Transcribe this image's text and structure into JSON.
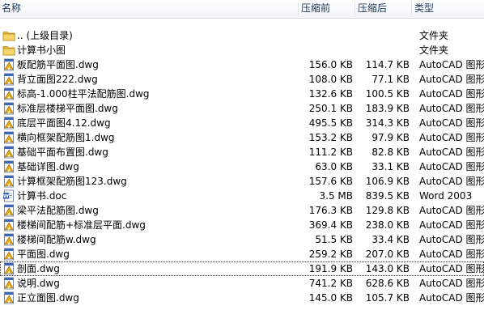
{
  "header": {
    "name": "名称",
    "original": "压缩前",
    "compressed": "压缩后",
    "type": "类型"
  },
  "rows": [
    {
      "name": ".. (上级目录)",
      "original": "",
      "compressed": "",
      "type": "文件夹",
      "icon": "folder-icon"
    },
    {
      "name": "计算书小图",
      "original": "",
      "compressed": "",
      "type": "文件夹",
      "icon": "folder-icon"
    },
    {
      "name": "板配筋平面图.dwg",
      "original": "156.0 KB",
      "compressed": "114.7 KB",
      "type": "AutoCAD 图形",
      "icon": "dwg-file-icon"
    },
    {
      "name": "背立面图222.dwg",
      "original": "108.0 KB",
      "compressed": "77.1 KB",
      "type": "AutoCAD 图形",
      "icon": "dwg-file-icon"
    },
    {
      "name": "标高-1.000柱平法配筋图.dwg",
      "original": "132.6 KB",
      "compressed": "100.5 KB",
      "type": "AutoCAD 图形",
      "icon": "dwg-file-icon"
    },
    {
      "name": "标准层楼梯平面图.dwg",
      "original": "250.1 KB",
      "compressed": "183.9 KB",
      "type": "AutoCAD 图形",
      "icon": "dwg-file-icon"
    },
    {
      "name": "底层平面图4.12.dwg",
      "original": "495.5 KB",
      "compressed": "314.3 KB",
      "type": "AutoCAD 图形",
      "icon": "dwg-file-icon"
    },
    {
      "name": "横向框架配筋图1.dwg",
      "original": "153.2 KB",
      "compressed": "97.9 KB",
      "type": "AutoCAD 图形",
      "icon": "dwg-file-icon"
    },
    {
      "name": "基础平面布置图.dwg",
      "original": "111.2 KB",
      "compressed": "82.8 KB",
      "type": "AutoCAD 图形",
      "icon": "dwg-file-icon"
    },
    {
      "name": "基础详图.dwg",
      "original": "63.0 KB",
      "compressed": "33.1 KB",
      "type": "AutoCAD 图形",
      "icon": "dwg-file-icon"
    },
    {
      "name": "计算框架配筋图123.dwg",
      "original": "157.6 KB",
      "compressed": "106.9 KB",
      "type": "AutoCAD 图形",
      "icon": "dwg-file-icon"
    },
    {
      "name": "计算书.doc",
      "original": "3.5 MB",
      "compressed": "839.5 KB",
      "type": "Word 2003",
      "icon": "word-doc-icon"
    },
    {
      "name": "梁平法配筋图.dwg",
      "original": "176.3 KB",
      "compressed": "129.8 KB",
      "type": "AutoCAD 图形",
      "icon": "dwg-file-icon"
    },
    {
      "name": "楼梯间配筋+标准层平面.dwg",
      "original": "369.4 KB",
      "compressed": "238.0 KB",
      "type": "AutoCAD 图形",
      "icon": "dwg-file-icon"
    },
    {
      "name": "楼梯间配筋w.dwg",
      "original": "51.5 KB",
      "compressed": "33.4 KB",
      "type": "AutoCAD 图形",
      "icon": "dwg-file-icon"
    },
    {
      "name": "平面图.dwg",
      "original": "259.2 KB",
      "compressed": "207.0 KB",
      "type": "AutoCAD 图形",
      "icon": "dwg-file-icon"
    },
    {
      "name": "剖面.dwg",
      "original": "191.9 KB",
      "compressed": "143.0 KB",
      "type": "AutoCAD 图形",
      "icon": "dwg-file-icon",
      "focused": true
    },
    {
      "name": "说明.dwg",
      "original": "741.2 KB",
      "compressed": "628.6 KB",
      "type": "AutoCAD 图形",
      "icon": "dwg-file-icon"
    },
    {
      "name": "正立面图.dwg",
      "original": "145.0 KB",
      "compressed": "105.7 KB",
      "type": "AutoCAD 图形",
      "icon": "dwg-file-icon"
    }
  ]
}
